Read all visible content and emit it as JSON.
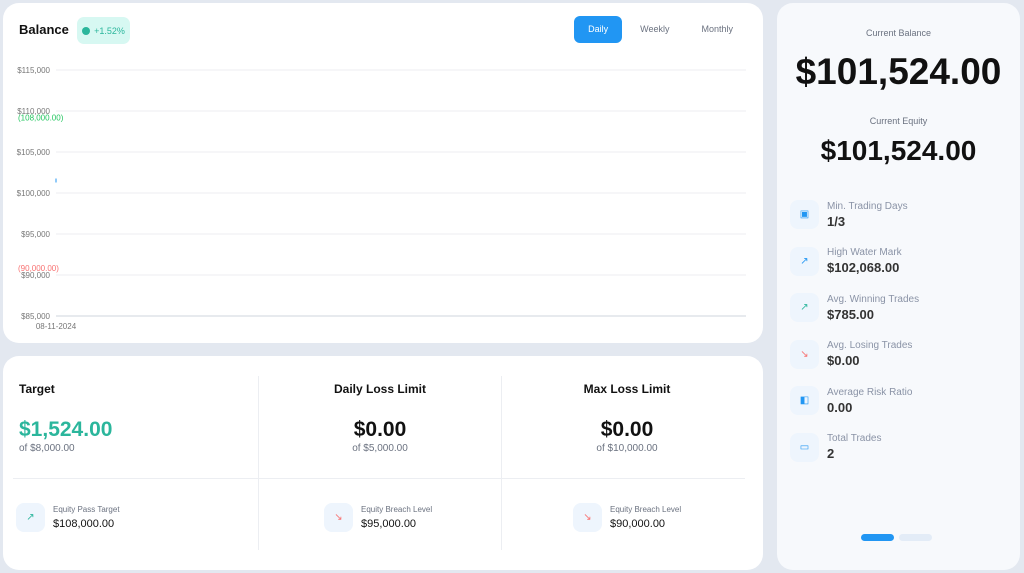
{
  "balance": {
    "title": "Balance",
    "change": "+1.52%",
    "tabs": [
      "Daily",
      "Weekly",
      "Monthly"
    ],
    "active_tab": "Daily"
  },
  "chart_data": {
    "type": "line",
    "x": [
      "08-11-2024"
    ],
    "series": [
      {
        "values": [
          101524
        ]
      }
    ],
    "ylim": [
      85000,
      115000
    ],
    "yticks": [
      "$115,000",
      "$110,000",
      "$105,000",
      "$100,000",
      "$95,000",
      "$90,000",
      "$85,000"
    ],
    "annotations": [
      {
        "label": "(108,000.00)",
        "value": 108000,
        "color": "#22c55e"
      },
      {
        "label": "(90,000.00)",
        "value": 90000,
        "color": "#f87171"
      }
    ],
    "grid": true
  },
  "target": {
    "title": "Target",
    "value": "$1,524.00",
    "of": "of $8,000.00",
    "sub_label": "Equity Pass Target",
    "sub_value": "$108,000.00"
  },
  "daily_loss": {
    "title": "Daily Loss Limit",
    "value": "$0.00",
    "of": "of $5,000.00",
    "sub_label": "Equity Breach Level",
    "sub_value": "$95,000.00"
  },
  "max_loss": {
    "title": "Max Loss Limit",
    "value": "$0.00",
    "of": "of $10,000.00",
    "sub_label": "Equity Breach Level",
    "sub_value": "$90,000.00"
  },
  "side": {
    "balance_label": "Current Balance",
    "balance": "$101,524.00",
    "equity_label": "Current Equity",
    "equity": "$101,524.00",
    "stats": [
      {
        "label": "Min. Trading Days",
        "value": "1/3",
        "icon": "calendar-check-icon"
      },
      {
        "label": "High Water Mark",
        "value": "$102,068.00",
        "icon": "trend-up-icon"
      },
      {
        "label": "Avg. Winning Trades",
        "value": "$785.00",
        "icon": "trend-up-icon"
      },
      {
        "label": "Avg. Losing Trades",
        "value": "$0.00",
        "icon": "trend-down-icon"
      },
      {
        "label": "Average Risk Ratio",
        "value": "0.00",
        "icon": "wallet-icon"
      },
      {
        "label": "Total Trades",
        "value": "2",
        "icon": "cash-icon"
      }
    ]
  },
  "colors": {
    "accent": "#2196f3",
    "green": "#2bb69c",
    "red": "#f87171"
  }
}
